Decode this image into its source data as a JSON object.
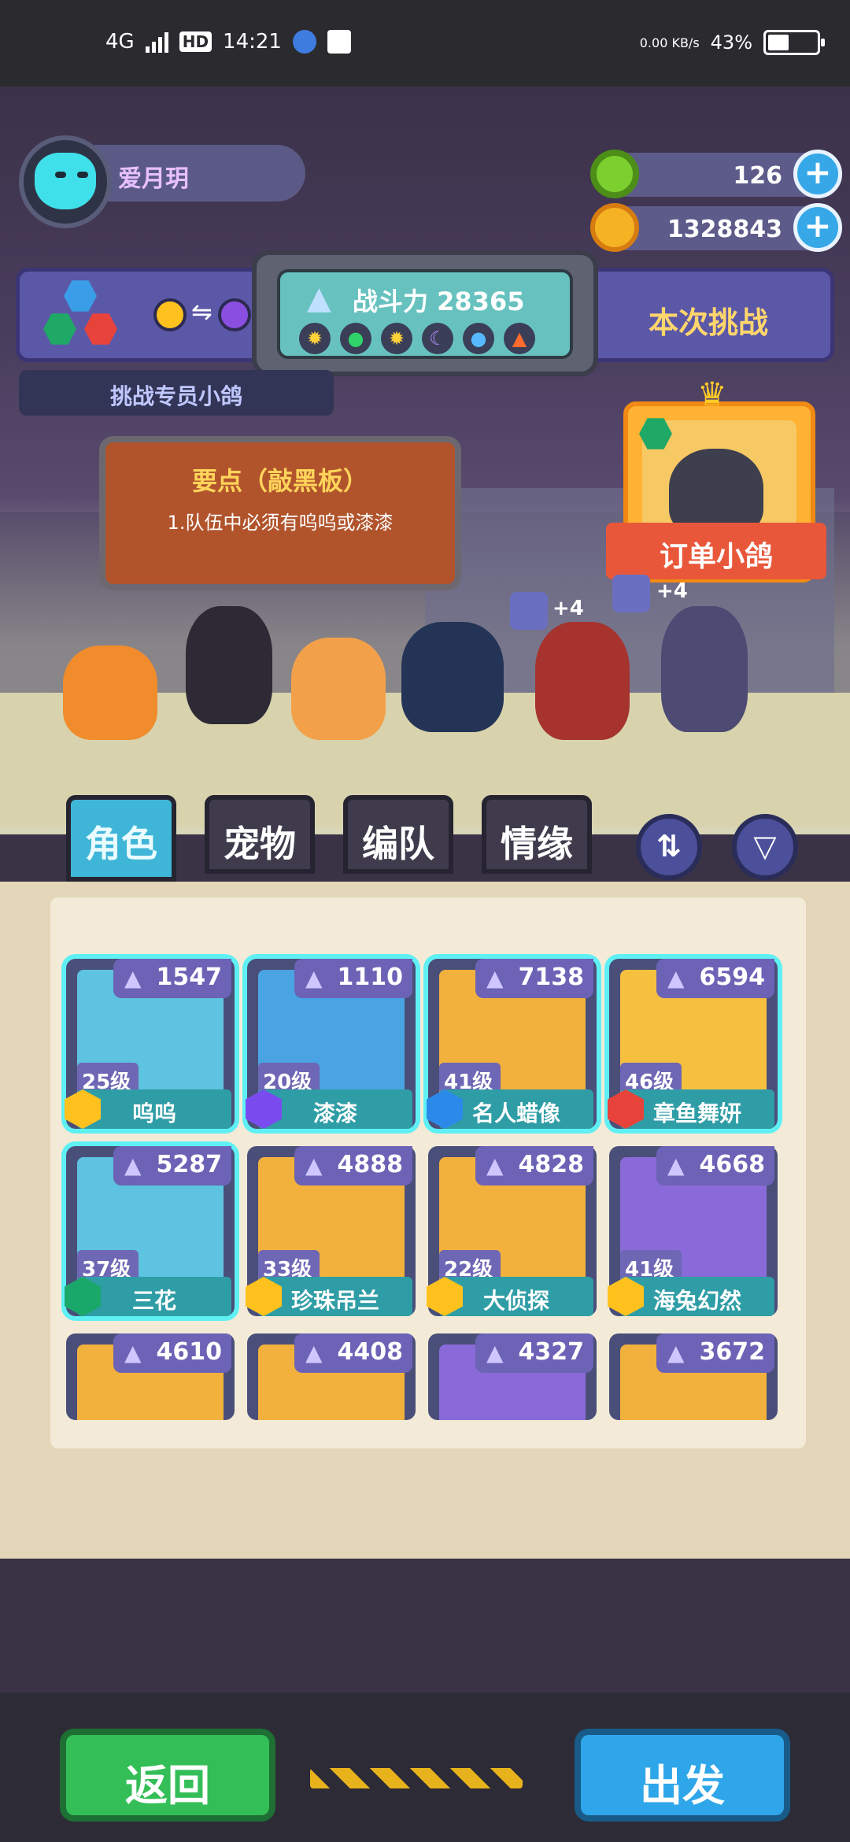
{
  "status_bar": {
    "network": "4G",
    "hd": "HD",
    "time": "14:21",
    "speed": "0.00 KB/s",
    "battery": "43%",
    "battery_level": 0.43
  },
  "player": {
    "name": "爱月玥"
  },
  "currencies": [
    {
      "name": "donut",
      "value": "126",
      "icon_color": "#7bcf2e"
    },
    {
      "name": "planet-coin",
      "value": "1328843",
      "icon_color": "#f5b324"
    }
  ],
  "challenge": {
    "power_label": "战斗力 28365",
    "right_label": "本次挑战",
    "target_label": "挑战专员小鸽",
    "elements": [
      "sun",
      "leaf",
      "sun",
      "moon",
      "water",
      "fire"
    ]
  },
  "notice": {
    "title": "要点（敲黑板）",
    "text": "1.队伍中必须有呜呜或漆漆"
  },
  "boss": {
    "name": "订单小鸽"
  },
  "stage_bonus": [
    "+4",
    "+4"
  ],
  "tabs": [
    "角色",
    "宠物",
    "编队",
    "情缘"
  ],
  "characters": [
    {
      "power": "1547",
      "level": "25级",
      "name": "呜呜",
      "badge_color": "#ffc11e",
      "art_color": "#5ec3e0",
      "selected": true
    },
    {
      "power": "1110",
      "level": "20级",
      "name": "漆漆",
      "badge_color": "#7a4cf0",
      "art_color": "#4aa4e3",
      "selected": true
    },
    {
      "power": "7138",
      "level": "41级",
      "name": "名人蜡像",
      "badge_color": "#2b8ae9",
      "art_color": "#f2b13c",
      "selected": true
    },
    {
      "power": "6594",
      "level": "46级",
      "name": "章鱼舞妍",
      "badge_color": "#e8433a",
      "art_color": "#f6c03f",
      "selected": true
    },
    {
      "power": "5287",
      "level": "37级",
      "name": "三花",
      "badge_color": "#19a86a",
      "art_color": "#5ec3e0",
      "selected": true
    },
    {
      "power": "4888",
      "level": "33级",
      "name": "珍珠吊兰",
      "badge_color": "#ffc11e",
      "art_color": "#f2b13c",
      "selected": false
    },
    {
      "power": "4828",
      "level": "22级",
      "name": "大侦探",
      "badge_color": "#ffc11e",
      "art_color": "#f2b13c",
      "selected": false
    },
    {
      "power": "4668",
      "level": "41级",
      "name": "海兔幻然",
      "badge_color": "#ffc11e",
      "art_color": "#8a6ad8",
      "selected": false
    },
    {
      "power": "4610",
      "level": "",
      "name": "",
      "badge_color": "",
      "art_color": "#f2b13c",
      "selected": false
    },
    {
      "power": "4408",
      "level": "",
      "name": "",
      "badge_color": "",
      "art_color": "#f2b13c",
      "selected": false
    },
    {
      "power": "4327",
      "level": "",
      "name": "",
      "badge_color": "",
      "art_color": "#8a6ad8",
      "selected": false
    },
    {
      "power": "3672",
      "level": "",
      "name": "",
      "badge_color": "",
      "art_color": "#f2b13c",
      "selected": false
    }
  ],
  "buttons": {
    "back": "返回",
    "go": "出发"
  }
}
